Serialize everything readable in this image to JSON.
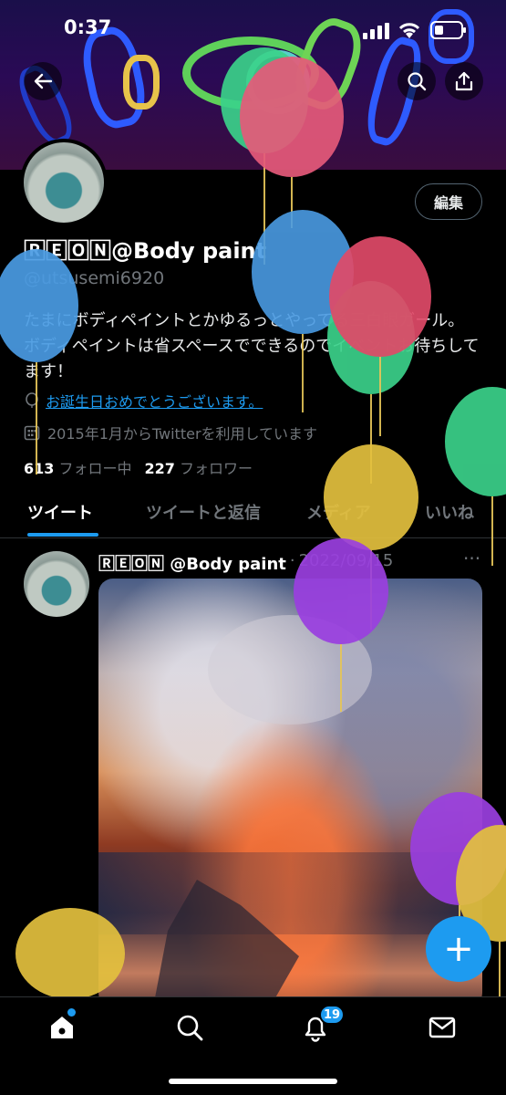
{
  "status_bar": {
    "time": "0:37"
  },
  "profile": {
    "display_name": "🅁🄴🄾🄽@Body paint",
    "handle": "@utsusemi6920",
    "edit_label": "編集",
    "bio": "たまにボディペイントとかゆるっとやってる三白眼ガール。 ボディペイントは省スペースでできるのでイベントお待ちしてます！",
    "birthday": "お誕生日おめでとうございます。",
    "joined": "2015年1月からTwitterを利用しています",
    "following_count": "613",
    "following_label": "フォロー中",
    "followers_count": "227",
    "followers_label": "フォロワー"
  },
  "tabs": [
    {
      "label": "ツイート"
    },
    {
      "label": "ツイートと返信"
    },
    {
      "label": "メディア"
    },
    {
      "label": "いいね"
    }
  ],
  "tweet": {
    "author": "🅁🄴🄾🄽 @Body paint",
    "date": "2022/09/15",
    "separator": "·",
    "more": "···"
  },
  "fab_label": "+",
  "nav": {
    "notification_count": "19"
  },
  "icons": {
    "back": "arrow-left-icon",
    "search": "search-icon",
    "share": "share-icon",
    "home": "home-icon",
    "notifications": "bell-icon",
    "messages": "mail-icon"
  },
  "colors": {
    "accent": "#1d9bf0",
    "background": "#000000"
  }
}
